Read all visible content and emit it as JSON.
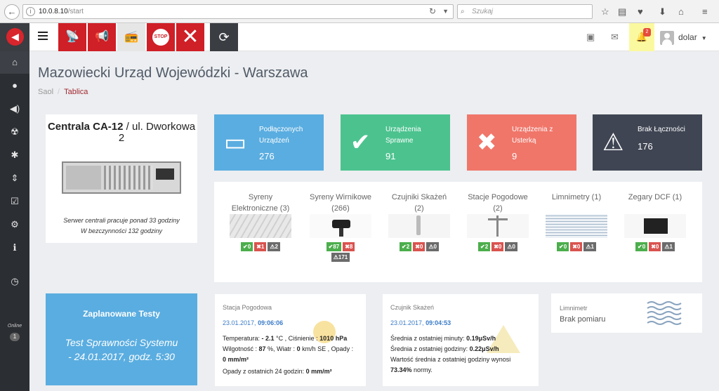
{
  "browser": {
    "url_host": "10.0.8.10",
    "url_path": "/start",
    "search_placeholder": "Szukaj"
  },
  "topbar": {
    "alert_buttons": [
      {
        "name": "siren-alarm-button",
        "icon": "antenna-alarm-icon",
        "glyph": "📡"
      },
      {
        "name": "announcement-button",
        "icon": "megaphone-icon",
        "glyph": "📢"
      },
      {
        "name": "radio-button",
        "icon": "radio-tower-icon",
        "glyph": "📻"
      },
      {
        "name": "stop-button",
        "icon": "stop-sign-icon",
        "label": "STOP"
      },
      {
        "name": "cancel-alarm-button",
        "icon": "close-icon",
        "glyph": "✕"
      }
    ],
    "notifications_count": "2",
    "user_name": "dolar"
  },
  "colors": {
    "brand_red": "#cf1f27",
    "blue": "#5aade0",
    "green": "#4cc38f",
    "salmon": "#f0766a",
    "dark": "#3f4553"
  },
  "page": {
    "title": "Mazowiecki Urząd Wojewódzki - Warszawa",
    "breadcrumb": [
      "Saol",
      "Tablica"
    ]
  },
  "centrala": {
    "title_bold": "Centrala CA-12",
    "title_rest": " / ul. Dworkowa 2",
    "line1": "Serwer centrali pracuje ponad 33 godziny",
    "line2": "W bezczynności 132 godziny"
  },
  "stats": [
    {
      "label": "Podłączonych Urządzeń",
      "value": "276"
    },
    {
      "label": "Urządzenia Sprawne",
      "value": "91"
    },
    {
      "label": "Urządzenia z Usterką",
      "value": "9"
    },
    {
      "label": "Brak Łączności",
      "value": "176"
    }
  ],
  "devices": [
    {
      "name": "Syreny Elektroniczne (3)",
      "ok": "0",
      "err": "1",
      "warn": "2"
    },
    {
      "name": "Syreny Wirnikowe (266)",
      "ok": "87",
      "err": "8",
      "warn": "171"
    },
    {
      "name": "Czujniki Skażeń (2)",
      "ok": "2",
      "err": "0",
      "warn": "0"
    },
    {
      "name": "Stacje Pogodowe (2)",
      "ok": "2",
      "err": "0",
      "warn": "0"
    },
    {
      "name": "Limnimetry (1)",
      "ok": "0",
      "err": "0",
      "warn": "1"
    },
    {
      "name": "Zegary DCF (1)",
      "ok": "0",
      "err": "0",
      "warn": "1"
    }
  ],
  "planned": {
    "title": "Zaplanowane Testy",
    "text": "Test Sprawności Systemu - 24.01.2017, godz. 5:30"
  },
  "weather": {
    "title": "Stacja Pogodowa",
    "date": "23.01.2017,",
    "time": "09:06:06",
    "temp_label": "Temperatura: ",
    "temp_value": "- 2.1",
    "temp_unit": " °C , Ciśnienie : ",
    "pressure": "1010 hPa",
    "humidity_label": "Wilgotność : ",
    "humidity": "87",
    "wind_label": " %, Wiatr : ",
    "wind": "0",
    "wind_unit": " km/h  SE , Opady :",
    "rain": "0 mm/m²",
    "rain24_label": "Opady z ostatnich 24 godzin: ",
    "rain24": "0 mm/m²"
  },
  "radiation": {
    "title": "Czujnik Skażeń",
    "date": "23.01.2017,",
    "time": "09:04:53",
    "minute_label": "Średnia z ostatniej minuty: ",
    "minute_value": "0.19μSv/h",
    "hour_label": "Średnia z ostatniej godziny: ",
    "hour_value": "0.22μSv/h",
    "pct_label": "Wartość średnia z ostatniej godziny wynosi",
    "pct_value": "73.34%",
    "pct_suffix": " normy."
  },
  "limnimeter": {
    "title": "Limnimetr",
    "value": "Brak pomiaru"
  },
  "sidebar": {
    "online_label": "Online",
    "online_count": "1"
  }
}
